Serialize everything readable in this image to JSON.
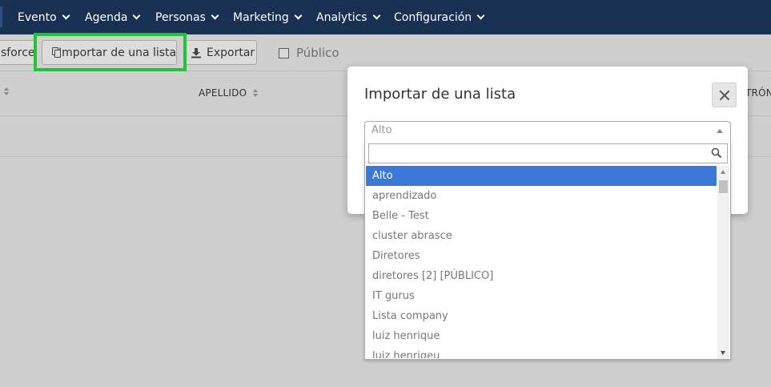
{
  "nav": {
    "items": [
      {
        "label": "Evento"
      },
      {
        "label": "Agenda"
      },
      {
        "label": "Personas"
      },
      {
        "label": "Marketing"
      },
      {
        "label": "Analytics"
      },
      {
        "label": "Configuración"
      }
    ]
  },
  "toolbar": {
    "salesforce_label": "sforce",
    "import_label": "Importar de una lista",
    "export_label": "Exportar",
    "public_label": "Público"
  },
  "table": {
    "headers": [
      "APELLIDO",
      "TRÓN"
    ]
  },
  "modal": {
    "title": "Importar de una lista",
    "select_value": "Alto",
    "search_value": "",
    "options": [
      "Alto",
      "aprendizado",
      "Belle - Test",
      "cluster abrasce",
      "Diretores",
      "diretores [2] [PÚBLICO]",
      "IT gurus",
      "Lista company",
      "luiz henrique",
      "luiz henriqeu"
    ],
    "selected_index": 0
  },
  "colors": {
    "nav_bg": "#183052",
    "highlight": "#22c23b",
    "selected_option": "#3c78d8"
  }
}
